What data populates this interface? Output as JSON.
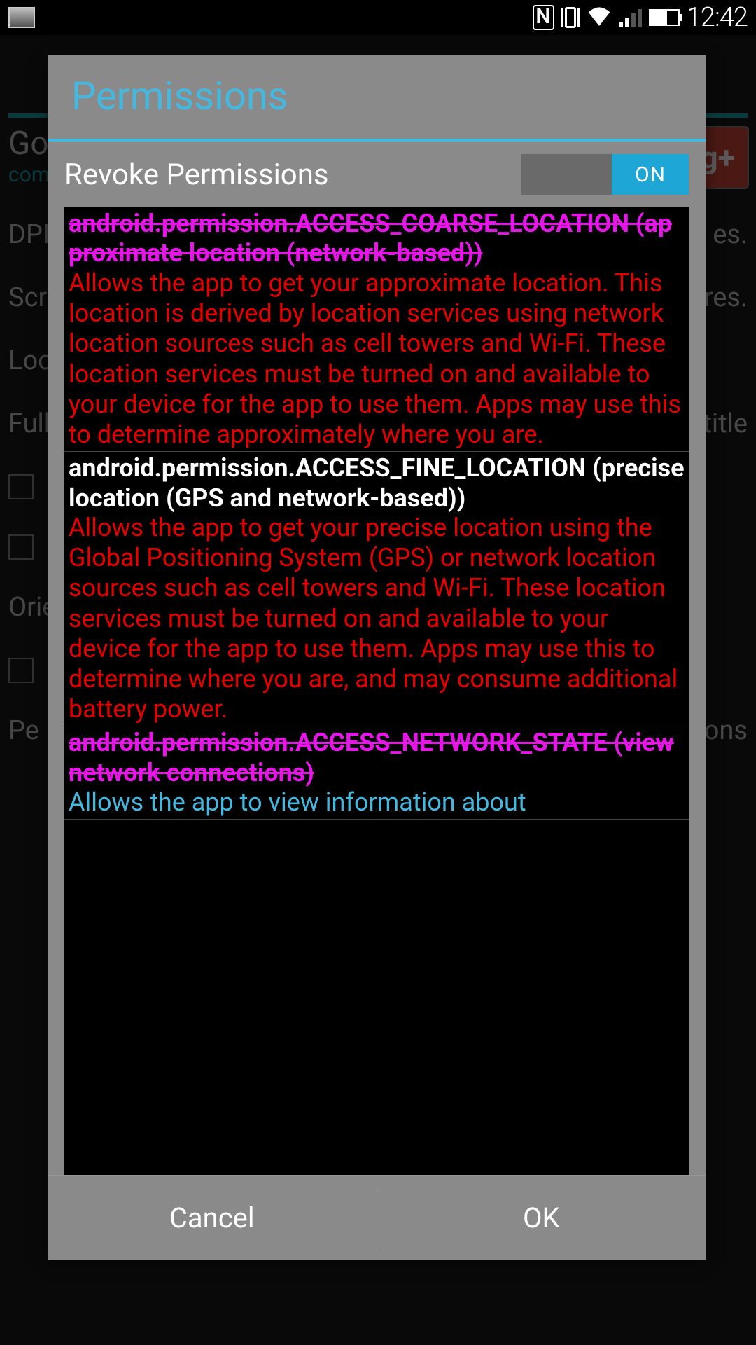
{
  "status": {
    "time": "12:42",
    "nfc": "N"
  },
  "bg": {
    "title": "Go",
    "sub": "com",
    "rows": {
      "dpi": {
        "label": "DPI",
        "val": "es."
      },
      "screen": {
        "label": "Scre",
        "val": "res."
      },
      "locale": {
        "label": "Loca"
      },
      "fullscreen": {
        "label": "Fulls",
        "val": "title"
      },
      "orientation": {
        "label": "Orie"
      },
      "perms": {
        "label": "Pe",
        "val": "ons"
      }
    },
    "gplus": "g+"
  },
  "dialog": {
    "title": "Permissions",
    "toggle_label": "Revoke Permissions",
    "toggle_state": "ON",
    "cancel": "Cancel",
    "ok": "OK"
  },
  "permissions": [
    {
      "name": "android.permission.ACCESS_COARSE_LOCATION (approximate location (network-based))",
      "desc": "Allows the app to get your approximate location. This location is derived by location services using network location sources such as cell towers and Wi-Fi. These location services must be turned on and available to your device for the app to use them. Apps may use this to determine approximately where you are.",
      "state": "revoked"
    },
    {
      "name": "android.permission.ACCESS_FINE_LOCATION (precise location (GPS and network-based))",
      "desc": "Allows the app to get your precise location using the Global Positioning System (GPS) or network location sources such as cell towers and Wi-Fi. These location services must be turned on and available to your device for the app to use them. Apps may use this to determine where you are, and may consume additional battery power.",
      "state": "active"
    },
    {
      "name": "android.permission.ACCESS_NETWORK_STATE (view network connections)",
      "desc": "Allows the app to view information about",
      "state": "partial_revoked"
    }
  ]
}
